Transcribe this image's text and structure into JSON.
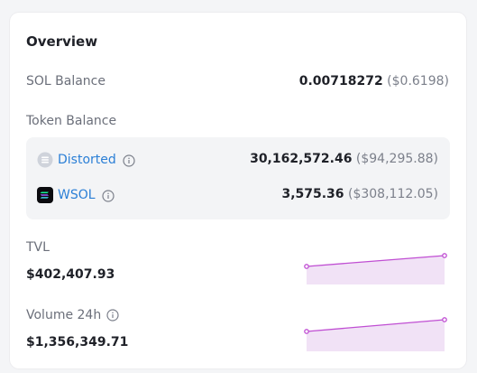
{
  "overview": {
    "title": "Overview",
    "sol_balance": {
      "label": "SOL Balance",
      "amount": "0.00718272",
      "usd": "($0.6198)"
    },
    "token_balance": {
      "label": "Token Balance",
      "tokens": [
        {
          "name": "Distorted",
          "amount": "30,162,572.46",
          "usd": "($94,295.88)",
          "icon": "distorted-token-icon"
        },
        {
          "name": "WSOL",
          "amount": "3,575.36",
          "usd": "($308,112.05)",
          "icon": "wsol-token-icon"
        }
      ]
    },
    "tvl": {
      "label": "TVL",
      "value": "$402,407.93"
    },
    "volume": {
      "label": "Volume 24h",
      "value": "$1,356,349.71"
    }
  },
  "colors": {
    "link": "#2b7fd6",
    "sparkline": "#c04fd3",
    "sparkline_fill": "#f1e2f6"
  }
}
